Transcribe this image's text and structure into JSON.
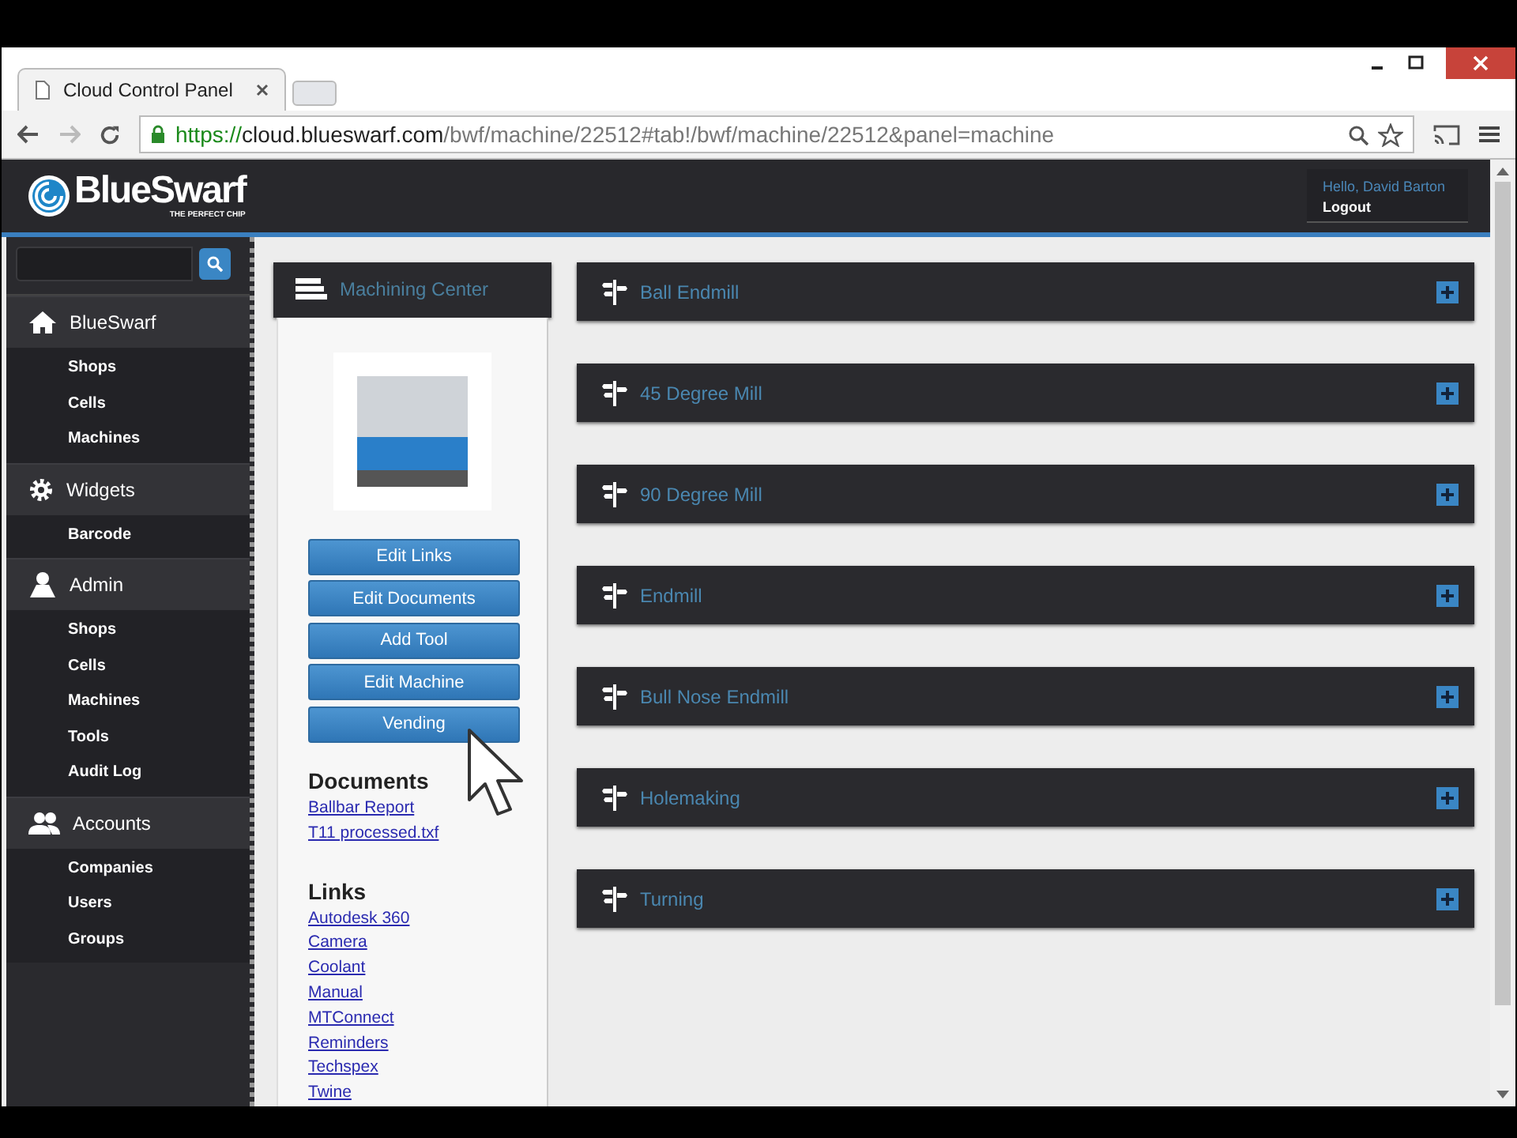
{
  "browser": {
    "tab_title": "Cloud Control Panel",
    "url_scheme": "https://",
    "url_host": "cloud.blueswarf.com",
    "url_path": "/bwf/machine/22512#tab!/bwf/machine/22512&panel=machine"
  },
  "header": {
    "logo": "BlueSwarf",
    "tagline": "THE PERFECT CHIP",
    "greeting": "Hello, David Barton",
    "logout": "Logout"
  },
  "sidebar": {
    "sections": [
      {
        "title": "BlueSwarf",
        "kind": "home",
        "items": [
          "Shops",
          "Cells",
          "Machines"
        ]
      },
      {
        "title": "Widgets",
        "kind": "gear",
        "items": [
          "Barcode"
        ]
      },
      {
        "title": "Admin",
        "kind": "user",
        "items": [
          "Shops",
          "Cells",
          "Machines",
          "Tools",
          "Audit Log"
        ]
      },
      {
        "title": "Accounts",
        "kind": "users",
        "items": [
          "Companies",
          "Users",
          "Groups"
        ]
      }
    ]
  },
  "machine": {
    "title": "Machining Center",
    "buttons": [
      "Edit Links",
      "Edit Documents",
      "Add Tool",
      "Edit Machine",
      "Vending"
    ],
    "documents_heading": "Documents",
    "documents": [
      "Ballbar Report",
      "T11 processed.txf"
    ],
    "links_heading": "Links",
    "links": [
      "Autodesk 360",
      "Camera",
      "Coolant",
      "Manual",
      "MTConnect",
      "Reminders",
      "Techspex",
      "Twine"
    ]
  },
  "tool_groups": [
    "Ball Endmill",
    "45 Degree Mill",
    "90 Degree Mill",
    "Endmill",
    "Bull Nose Endmill",
    "Holemaking",
    "Turning"
  ]
}
